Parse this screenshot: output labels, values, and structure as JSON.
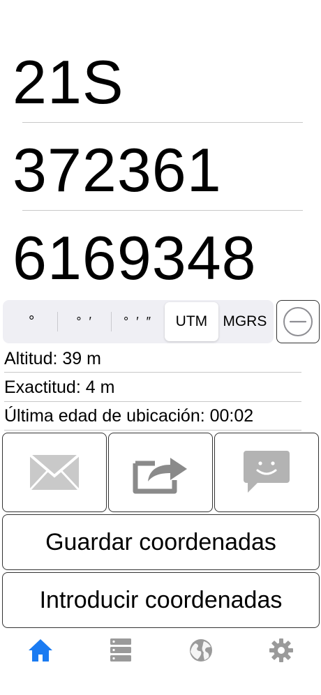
{
  "coordinates": {
    "zone": "21S",
    "easting": "372361",
    "northing": "6169348"
  },
  "format_selector": {
    "options": [
      "°",
      "° ′",
      "° ′ ″",
      "UTM",
      "MGRS"
    ],
    "selected": "UTM"
  },
  "info": {
    "altitude": "Altitud: 39 m",
    "accuracy": "Exactitud: 4 m",
    "location_age": "Última edad de ubicación: 00:02"
  },
  "actions": {
    "mail_icon": "envelope-icon",
    "share_icon": "share-arrow-icon",
    "message_icon": "message-bubble-icon",
    "save_label": "Guardar coordenadas",
    "enter_label": "Introducir coordenadas"
  },
  "tabs": [
    {
      "icon": "home-icon",
      "active": true
    },
    {
      "icon": "server-list-icon",
      "active": false
    },
    {
      "icon": "globe-icon",
      "active": false
    },
    {
      "icon": "gear-icon",
      "active": false
    }
  ],
  "colors": {
    "accent": "#1a7bf2",
    "inactive_icon": "#9a9a9a",
    "icon_gray": "#b3b3b3"
  }
}
